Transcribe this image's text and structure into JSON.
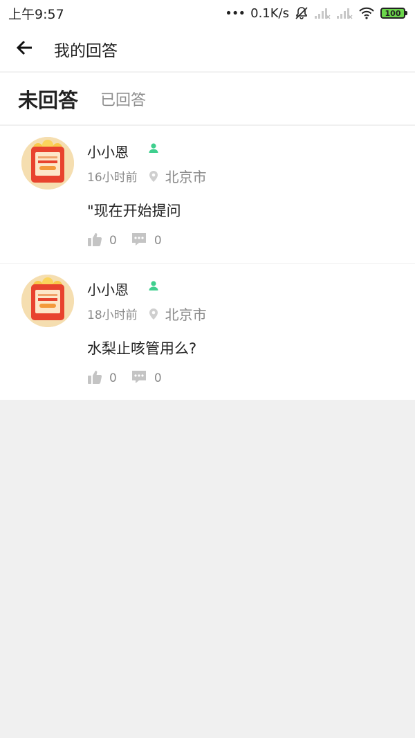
{
  "status_bar": {
    "time": "上午9:57",
    "dots": "•••",
    "speed": "0.1K/s",
    "battery": "100",
    "icons": [
      "mute-bell-icon",
      "signal-icon",
      "signal-icon",
      "wifi-icon",
      "battery-icon"
    ]
  },
  "header": {
    "title": "我的回答",
    "back_icon": "arrow-left-icon"
  },
  "tabs": [
    {
      "label": "未回答",
      "active": true
    },
    {
      "label": "已回答",
      "active": false
    }
  ],
  "items": [
    {
      "user": "小小恩",
      "time": "16小时前",
      "location": "北京市",
      "content": "\"现在开始提问",
      "likes": "0",
      "comments": "0"
    },
    {
      "user": "小小恩",
      "time": "18小时前",
      "location": "北京市",
      "content": "水梨止咳管用么?",
      "likes": "0",
      "comments": "0"
    }
  ],
  "colors": {
    "badge_green": "#3fcf8e",
    "meta_gray": "#8a8a8a",
    "background": "#f0f0f0",
    "battery_green": "#6bd64b"
  }
}
